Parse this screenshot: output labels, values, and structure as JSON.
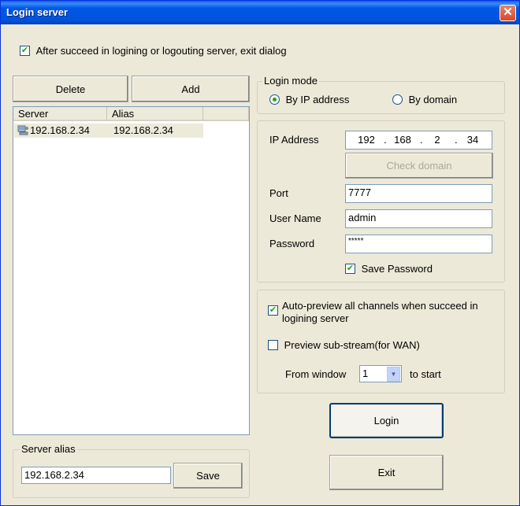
{
  "window": {
    "title": "Login server",
    "close_glyph": "✕"
  },
  "exit_dialog_option": {
    "label": "After succeed in logining or logouting server, exit dialog",
    "checked": true
  },
  "list_buttons": {
    "delete": "Delete",
    "add": "Add"
  },
  "server_list": {
    "columns": [
      "Server",
      "Alias"
    ],
    "rows": [
      {
        "icon": "server-icon",
        "server": "192.168.2.34",
        "alias": "192.168.2.34"
      }
    ]
  },
  "server_alias": {
    "group_label": "Server alias",
    "value": "192.168.2.34",
    "save_label": "Save"
  },
  "login_mode": {
    "group_label": "Login mode",
    "options": [
      {
        "label": "By IP address",
        "selected": true
      },
      {
        "label": "By domain",
        "selected": false
      }
    ]
  },
  "connection": {
    "ip_label": "IP Address",
    "ip_octets": [
      "192",
      "168",
      "2",
      "34"
    ],
    "check_domain_label": "Check domain",
    "port_label": "Port",
    "port_value": "7777",
    "username_label": "User Name",
    "username_value": "admin",
    "password_label": "Password",
    "password_value": "*****",
    "save_password": {
      "label": "Save Password",
      "checked": true
    }
  },
  "preview": {
    "auto_preview": {
      "label_line1": "Auto-preview all channels when succeed in",
      "label_line2": "logining server",
      "checked": true
    },
    "sub_stream": {
      "label": "Preview sub-stream(for WAN)",
      "checked": false
    },
    "from_window_label": "From window",
    "from_window_value": "1",
    "to_start_label": "to start"
  },
  "actions": {
    "login": "Login",
    "exit": "Exit"
  },
  "colors": {
    "titlebar": "#0054E3",
    "dialog_bg": "#ECE9D8",
    "check": "#21A121"
  }
}
